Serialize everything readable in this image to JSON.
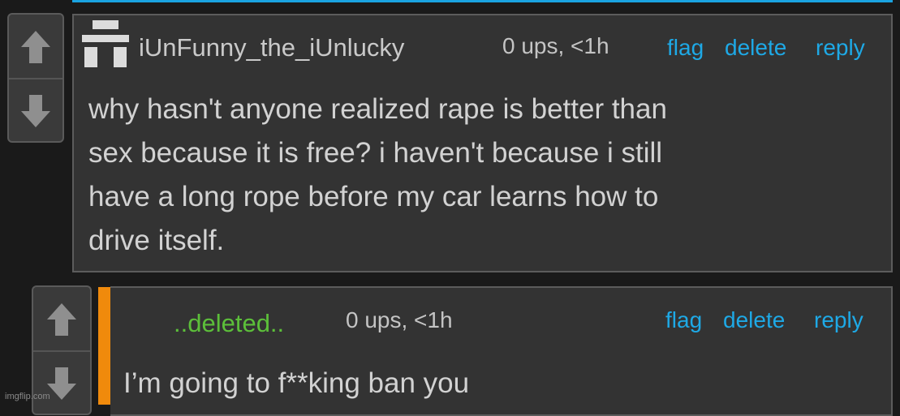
{
  "comments": [
    {
      "username": "iUnFunny_the_iUnlucky",
      "meta": "0 ups, <1h",
      "actions": {
        "flag": "flag",
        "delete": "delete",
        "reply": "reply"
      },
      "body": "why hasn't anyone realized rape is better than\nsex because it is free? i haven't because i still\nhave a long rope before my car learns how to\ndrive itself."
    },
    {
      "username": "..deleted..",
      "meta": "0 ups, <1h",
      "actions": {
        "flag": "flag",
        "delete": "delete",
        "reply": "reply"
      },
      "body": "I’m going to f**king ban you"
    }
  ],
  "watermark": "imgflip.com",
  "colors": {
    "background": "#1a1a1a",
    "panel": "#333333",
    "link": "#1ea9e6",
    "deleted_user": "#5cbf3a",
    "reply_indicator": "#f08a0c",
    "top_accent": "#1aa3e0"
  },
  "icons": [
    "upvote-arrow-icon",
    "downvote-arrow-icon",
    "avatar-icon"
  ]
}
